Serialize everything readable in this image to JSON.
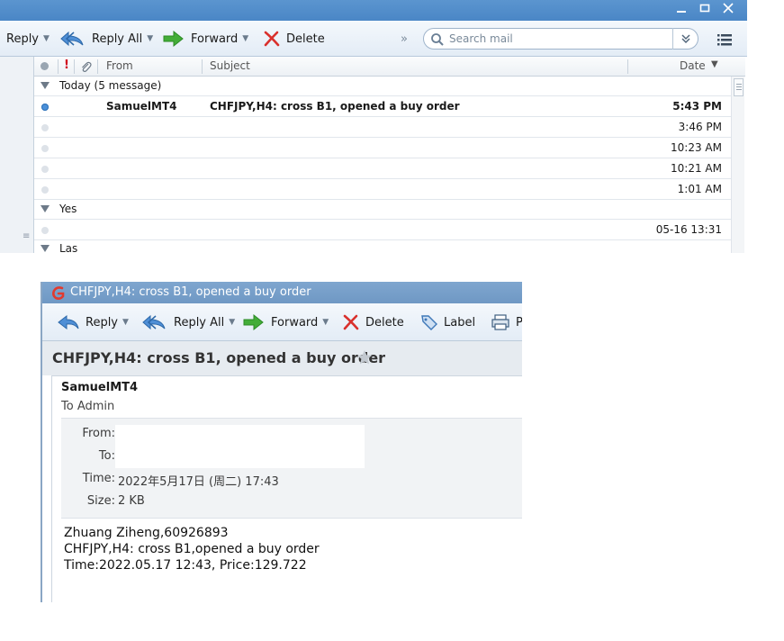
{
  "mail_window": {
    "toolbar": {
      "reply": "Reply",
      "reply_all": "Reply All",
      "forward": "Forward",
      "delete": "Delete",
      "more": "»",
      "search_placeholder": "Search mail"
    },
    "columns": {
      "from": "From",
      "subject": "Subject",
      "date": "Date"
    },
    "groups": [
      {
        "label": "Today (5 message)"
      },
      {
        "label": "Yes"
      },
      {
        "label": "Las"
      }
    ],
    "messages": [
      {
        "from": "SamuelMT4",
        "subject": "CHFJPY,H4: cross B1, opened a buy order",
        "date": "5:43 PM",
        "unread": true
      },
      {
        "from": "",
        "subject": "",
        "date": "3:46 PM",
        "unread": false
      },
      {
        "from": "",
        "subject": "",
        "date": "10:23 AM",
        "unread": false
      },
      {
        "from": "",
        "subject": "",
        "date": "10:21 AM",
        "unread": false
      },
      {
        "from": "",
        "subject": "",
        "date": "1:01 AM",
        "unread": false
      },
      {
        "from": "",
        "subject": "",
        "date": "05-16 13:31",
        "unread": false
      }
    ]
  },
  "message_window": {
    "title": "CHFJPY,H4: cross B1, opened a buy order",
    "toolbar": {
      "reply": "Reply",
      "reply_all": "Reply All",
      "forward": "Forward",
      "delete": "Delete",
      "label": "Label",
      "print": "P"
    },
    "subject": "CHFJPY,H4: cross B1, opened a buy order",
    "sender": "SamuelMT4",
    "to_line": "To Admin",
    "header": {
      "from_label": "From:",
      "to_label": "To:",
      "time_label": "Time:",
      "time_value": "2022年5月17日 (周二) 17:43",
      "size_label": "Size:",
      "size_value": "2 KB"
    },
    "body": [
      "Zhuang Ziheng,60926893",
      "CHFJPY,H4: cross B1,opened a buy order",
      "Time:2022.05.17 12:43,  Price:129.722"
    ]
  },
  "colors": {
    "titlebar": "#4a86c6",
    "unread_dot": "#4a90d9",
    "flag_red": "#d0021b",
    "forward_green": "#3fa535",
    "delete_red": "#d9302c"
  }
}
